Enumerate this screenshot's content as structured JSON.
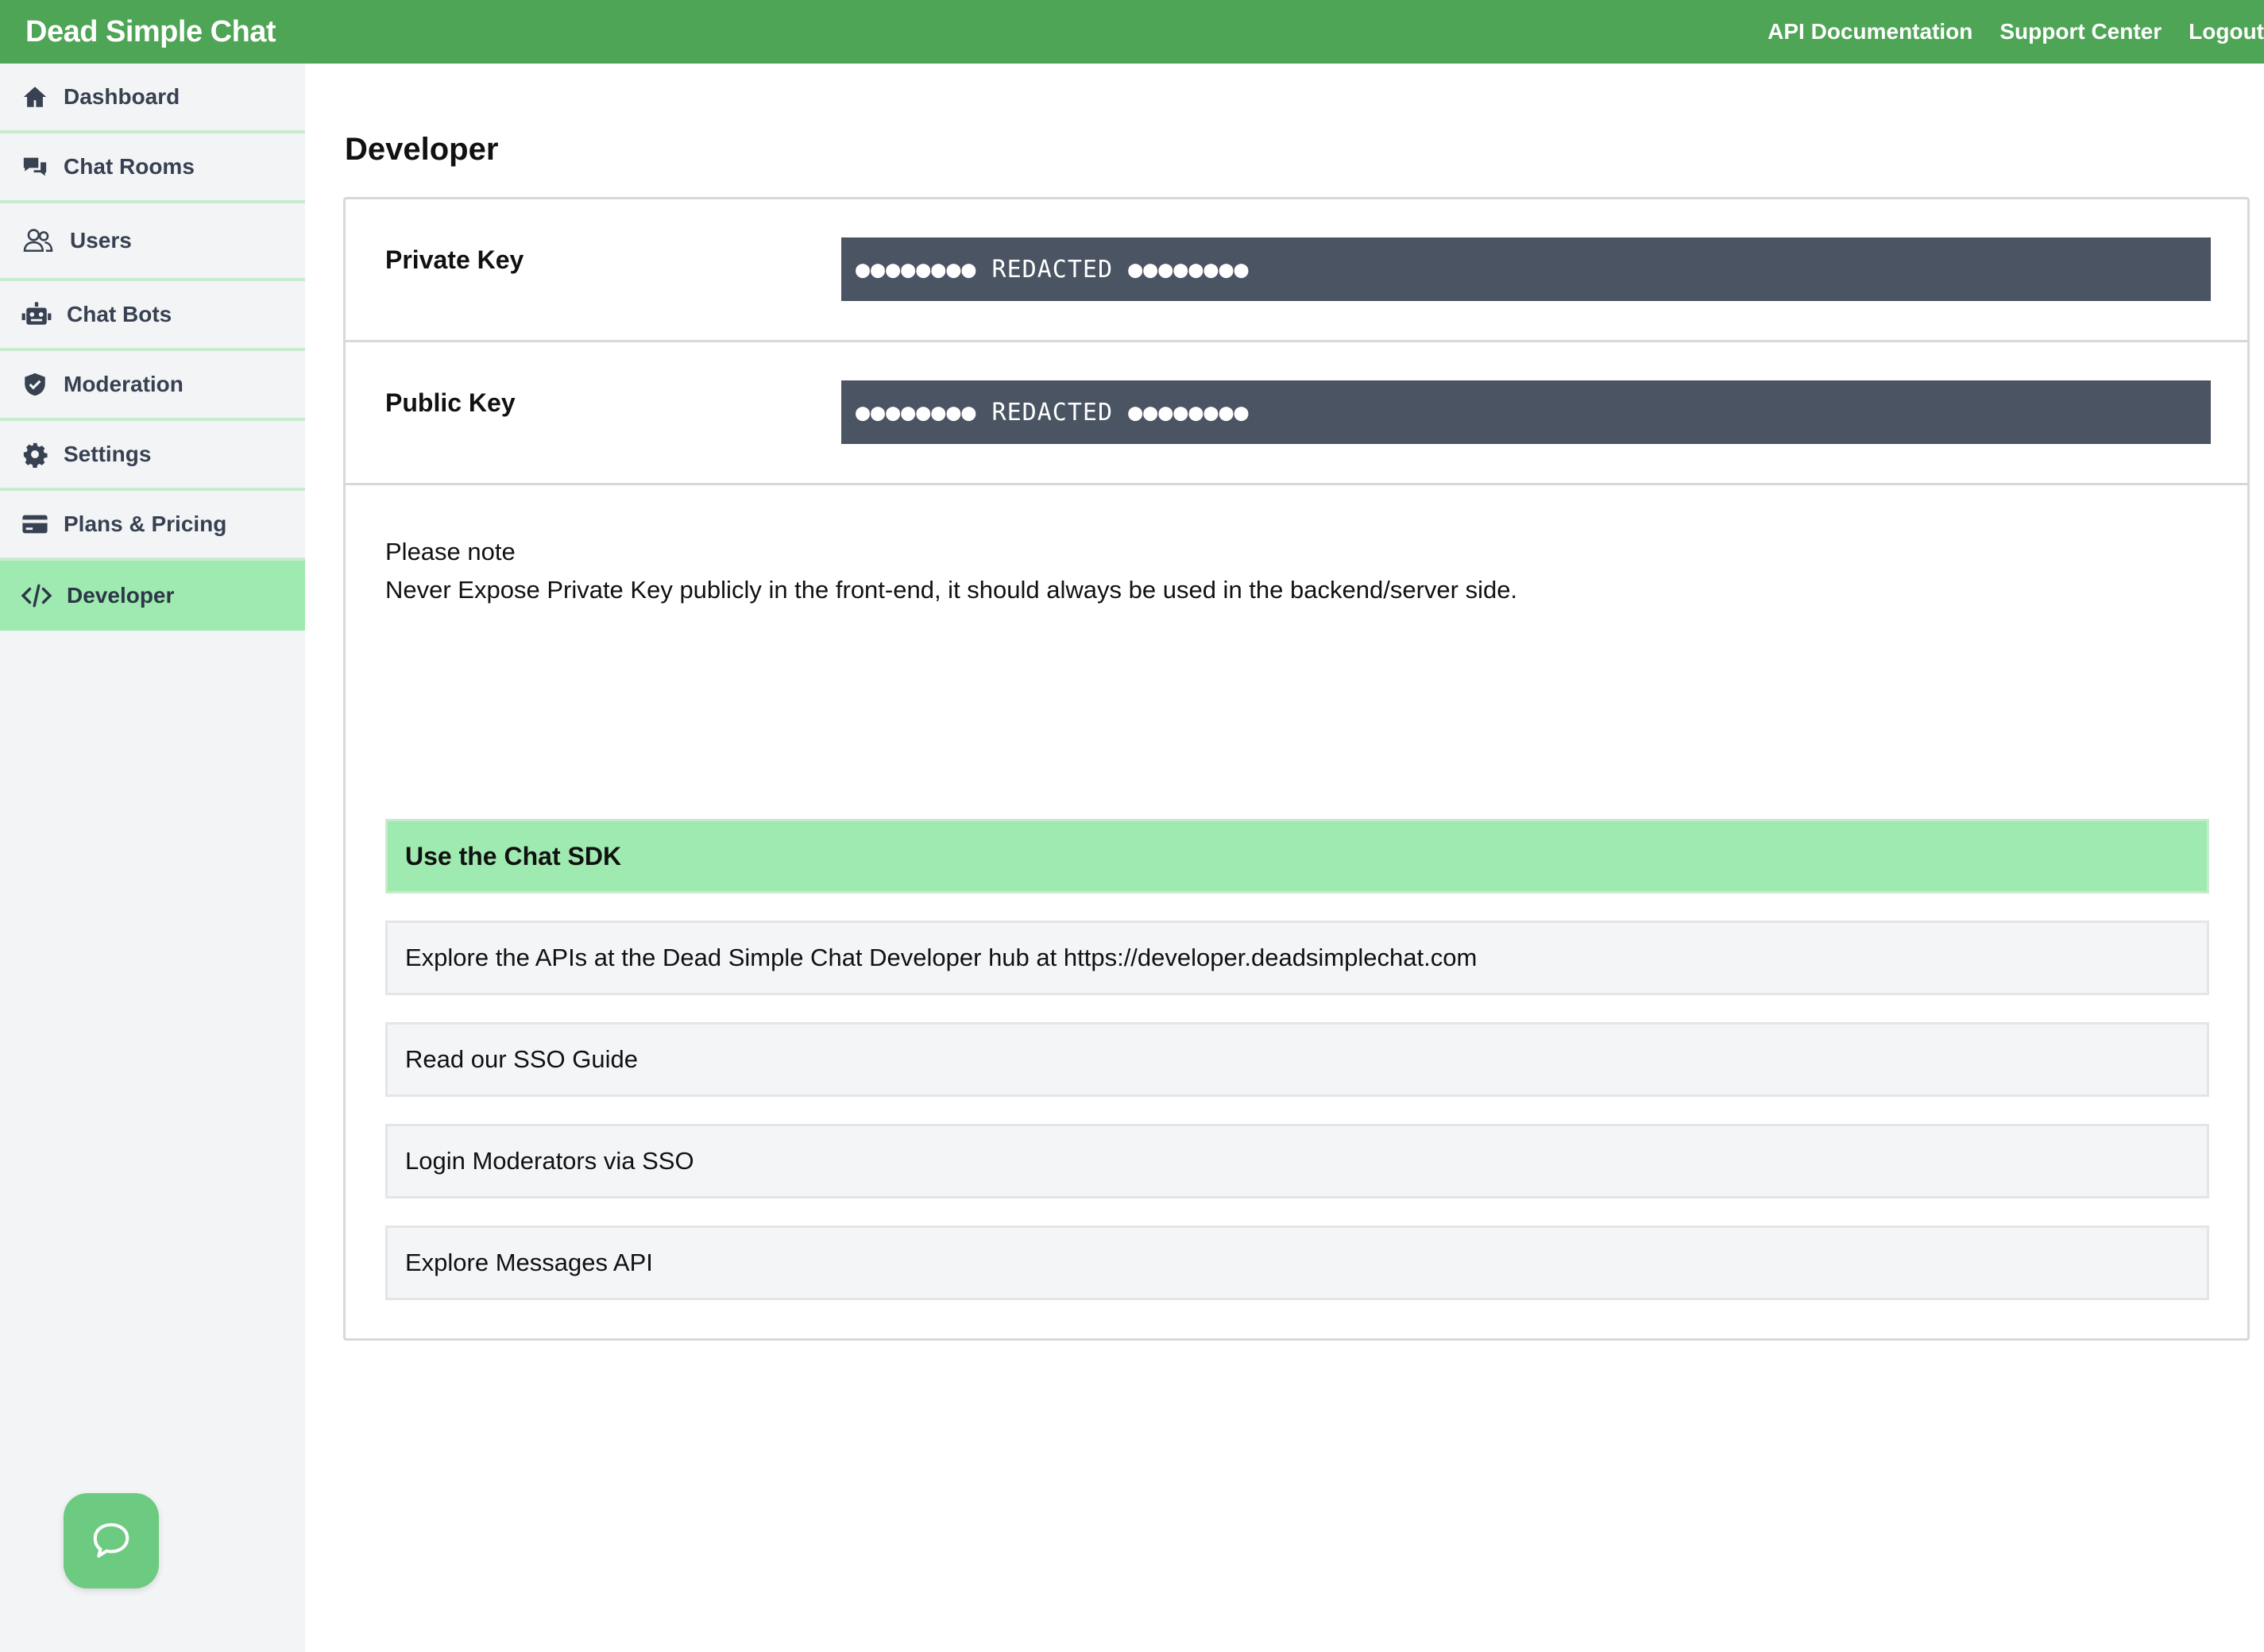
{
  "header": {
    "brand": "Dead Simple Chat",
    "links": [
      "API Documentation",
      "Support Center",
      "Logout"
    ],
    "brand_color": "#4ea556"
  },
  "sidebar": {
    "items": [
      {
        "label": "Dashboard",
        "icon": "home-icon"
      },
      {
        "label": "Chat Rooms",
        "icon": "chat-bubbles-icon"
      },
      {
        "label": "Users",
        "icon": "users-icon"
      },
      {
        "label": "Chat Bots",
        "icon": "robot-icon"
      },
      {
        "label": "Moderation",
        "icon": "shield-icon"
      },
      {
        "label": "Settings",
        "icon": "gear-icon"
      },
      {
        "label": "Plans & Pricing",
        "icon": "credit-card-icon"
      },
      {
        "label": "Developer",
        "icon": "code-icon",
        "active": true
      }
    ],
    "active_color": "#9eeab0"
  },
  "main": {
    "title": "Developer",
    "private_key": {
      "label": "Private Key",
      "value": "●●●●●●●● REDACTED ●●●●●●●●"
    },
    "public_key": {
      "label": "Public Key",
      "value": "●●●●●●●● REDACTED ●●●●●●●●"
    },
    "note": {
      "title": "Please note",
      "text": "Never Expose Private Key publicly in the front-end, it should always be used in the backend/server side."
    },
    "sdk": {
      "header": "Use the Chat SDK",
      "items": [
        "Explore the APIs at the Dead Simple Chat Developer hub at https://developer.deadsimplechat.com",
        "Read our SSO Guide",
        "Login Moderators via SSO",
        "Explore Messages API"
      ]
    }
  },
  "chat_widget": {
    "icon": "chat-icon",
    "color": "#6ccb80"
  }
}
